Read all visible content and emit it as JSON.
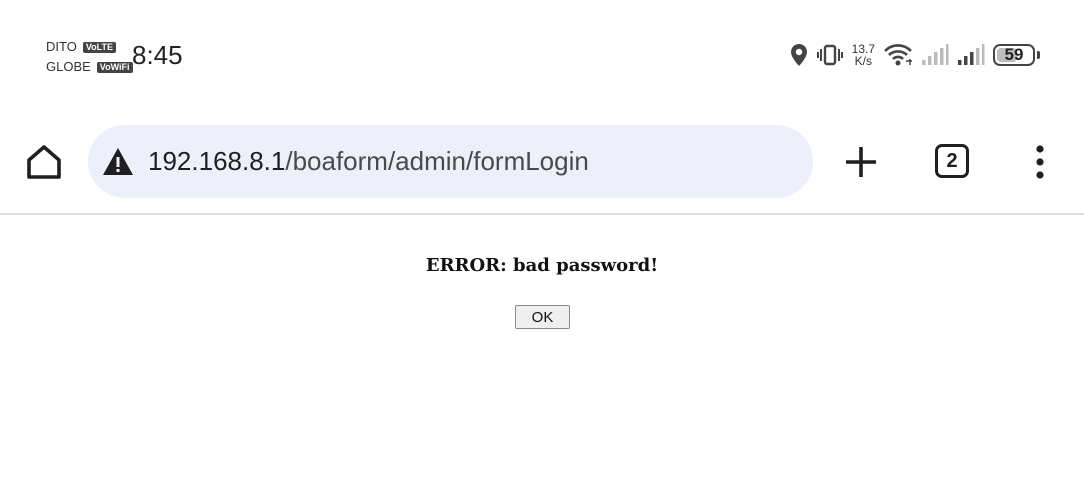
{
  "status_bar": {
    "carrier1": "DITO",
    "carrier1_badge": "VoLTE",
    "carrier2": "GLOBE",
    "carrier2_badge": "VoWiFi",
    "time": "8:45",
    "net_speed_value": "13.7",
    "net_speed_unit": "K/s",
    "battery_level": "59",
    "icons": [
      "location-icon",
      "vibrate-icon",
      "wifi-icon",
      "signal-icon",
      "signal-icon",
      "battery-icon"
    ]
  },
  "browser": {
    "url_host": "192.168.8.1",
    "url_path": "/boaform/admin/formLogin",
    "tab_count": "2",
    "icons": [
      "home-icon",
      "warning-icon",
      "plus-icon",
      "tabs-icon",
      "more-vert-icon"
    ]
  },
  "page": {
    "error_message": "ERROR: bad password!",
    "ok_label": "OK"
  }
}
